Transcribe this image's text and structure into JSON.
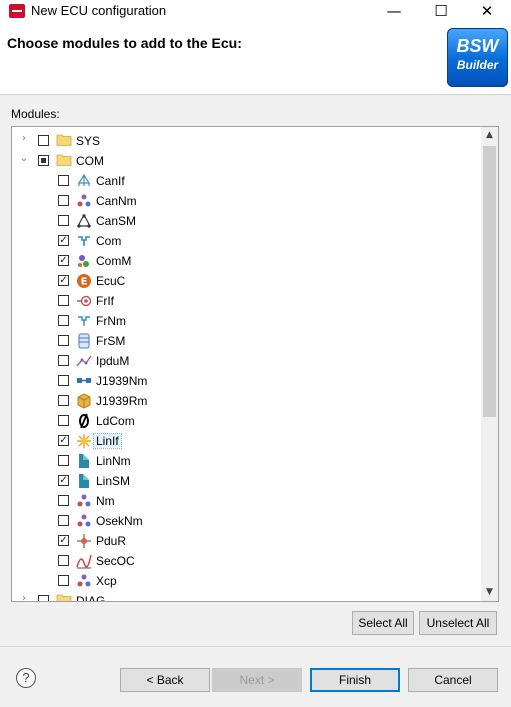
{
  "window": {
    "title": "New ECU configuration",
    "minimize_glyph": "—",
    "maximize_glyph": "☐",
    "close_glyph": "✕"
  },
  "header": {
    "title": "Choose modules to add to the Ecu:",
    "logo_line1": "BSW",
    "logo_line2": "Builder"
  },
  "modules_label": "Modules:",
  "tree": {
    "nodes": [
      {
        "label": "SYS",
        "level": 0,
        "expander": "collapsed",
        "check": "unchecked",
        "icon": "folder-icon"
      },
      {
        "label": "COM",
        "level": 0,
        "expander": "expanded",
        "check": "partial",
        "icon": "folder-icon"
      },
      {
        "label": "CanIf",
        "level": 1,
        "check": "unchecked",
        "icon": "canif-icon"
      },
      {
        "label": "CanNm",
        "level": 1,
        "check": "unchecked",
        "icon": "cannm-icon"
      },
      {
        "label": "CanSM",
        "level": 1,
        "check": "unchecked",
        "icon": "cansm-icon"
      },
      {
        "label": "Com",
        "level": 1,
        "check": "checked",
        "icon": "com-icon"
      },
      {
        "label": "ComM",
        "level": 1,
        "check": "checked",
        "icon": "comm-icon"
      },
      {
        "label": "EcuC",
        "level": 1,
        "check": "checked",
        "icon": "ecuc-icon"
      },
      {
        "label": "FrIf",
        "level": 1,
        "check": "unchecked",
        "icon": "frif-icon"
      },
      {
        "label": "FrNm",
        "level": 1,
        "check": "unchecked",
        "icon": "frnm-icon"
      },
      {
        "label": "FrSM",
        "level": 1,
        "check": "unchecked",
        "icon": "frsm-icon"
      },
      {
        "label": "IpduM",
        "level": 1,
        "check": "unchecked",
        "icon": "ipdum-icon"
      },
      {
        "label": "J1939Nm",
        "level": 1,
        "check": "unchecked",
        "icon": "j1939nm-icon"
      },
      {
        "label": "J1939Rm",
        "level": 1,
        "check": "unchecked",
        "icon": "j1939rm-icon"
      },
      {
        "label": "LdCom",
        "level": 1,
        "check": "unchecked",
        "icon": "ldcom-icon"
      },
      {
        "label": "LinIf",
        "level": 1,
        "check": "checked",
        "icon": "linif-icon",
        "selected": true
      },
      {
        "label": "LinNm",
        "level": 1,
        "check": "unchecked",
        "icon": "linnm-icon"
      },
      {
        "label": "LinSM",
        "level": 1,
        "check": "checked",
        "icon": "linsm-icon"
      },
      {
        "label": "Nm",
        "level": 1,
        "check": "unchecked",
        "icon": "nm-icon"
      },
      {
        "label": "OsekNm",
        "level": 1,
        "check": "unchecked",
        "icon": "oseknm-icon"
      },
      {
        "label": "PduR",
        "level": 1,
        "check": "checked",
        "icon": "pdur-icon"
      },
      {
        "label": "SecOC",
        "level": 1,
        "check": "unchecked",
        "icon": "secoc-icon"
      },
      {
        "label": "Xcp",
        "level": 1,
        "check": "unchecked",
        "icon": "xcp-icon"
      },
      {
        "label": "DIAG",
        "level": 0,
        "expander": "collapsed",
        "check": "unchecked",
        "icon": "folder-icon"
      }
    ]
  },
  "buttons": {
    "select_all": "Select All",
    "unselect_all": "Unselect All",
    "help": "?",
    "back": "< Back",
    "next": "Next >",
    "finish": "Finish",
    "cancel": "Cancel"
  },
  "colors": {
    "accent": "#0078d7",
    "logo_blue": "#0a6fd9",
    "window_bg": "#f0f0f0"
  }
}
